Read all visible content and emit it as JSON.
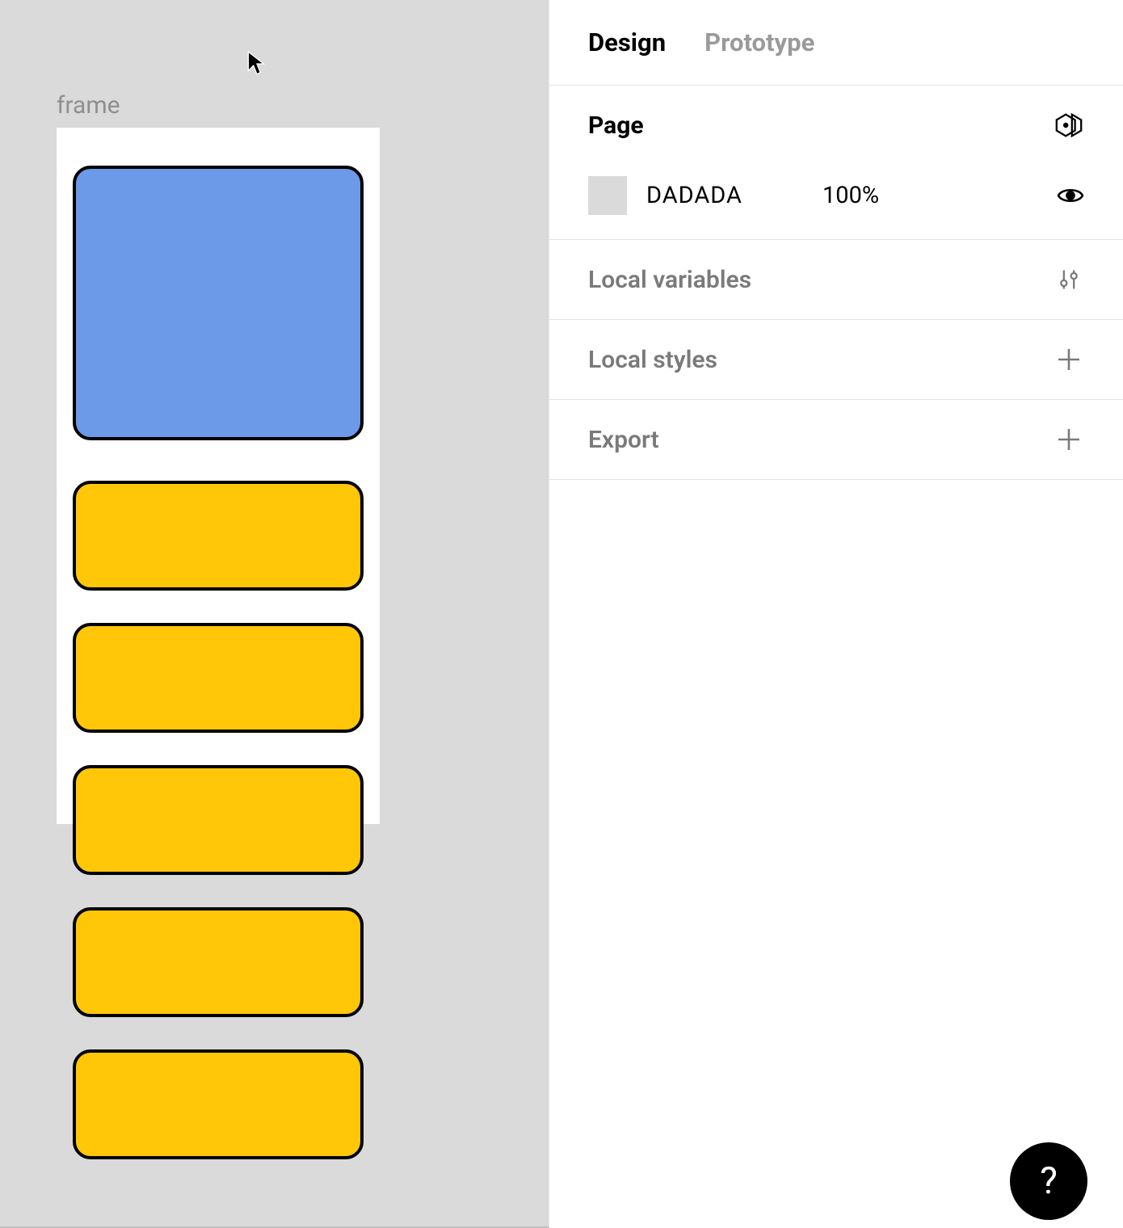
{
  "canvas": {
    "frame_label": "frame",
    "background_hex": "DADADA",
    "shapes": [
      {
        "type": "rect",
        "fill": "#6c99e8",
        "role": "hero"
      },
      {
        "type": "rect",
        "fill": "#ffc707",
        "role": "item"
      },
      {
        "type": "rect",
        "fill": "#ffc707",
        "role": "item"
      },
      {
        "type": "rect",
        "fill": "#ffc707",
        "role": "item"
      },
      {
        "type": "rect",
        "fill": "#ffc707",
        "role": "item"
      },
      {
        "type": "rect",
        "fill": "#ffc707",
        "role": "item"
      }
    ]
  },
  "inspector": {
    "tabs": {
      "design": "Design",
      "prototype": "Prototype",
      "active": "design"
    },
    "page": {
      "title": "Page",
      "color_hex": "DADADA",
      "opacity": "100%"
    },
    "local_variables": {
      "title": "Local variables"
    },
    "local_styles": {
      "title": "Local styles"
    },
    "export": {
      "title": "Export"
    }
  },
  "help": {
    "label": "?"
  }
}
